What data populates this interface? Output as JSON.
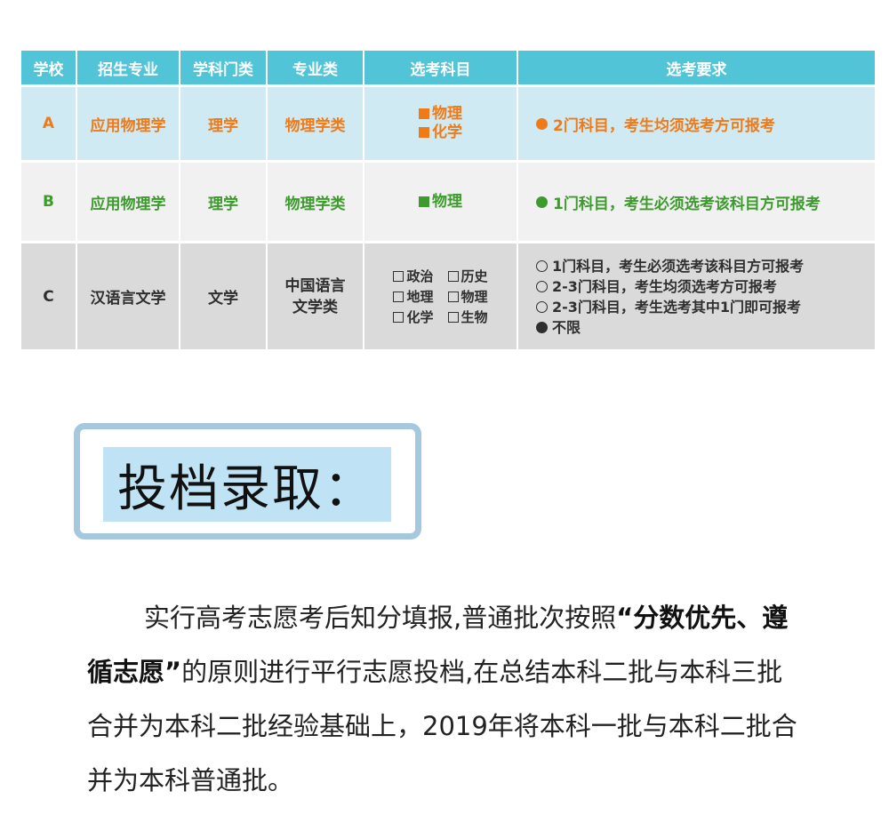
{
  "table": {
    "headers": [
      "学校",
      "招生专业",
      "学科门类",
      "专业类",
      "选考科目",
      "选考要求"
    ],
    "rows": [
      {
        "school": "A",
        "major": "应用物理学",
        "category": "理学",
        "field": "物理学类",
        "subjects": [
          "物理",
          "化学"
        ],
        "requirement": "2门科目，考生均须选考方可报考"
      },
      {
        "school": "B",
        "major": "应用物理学",
        "category": "理学",
        "field": "物理学类",
        "subjects": [
          "物理"
        ],
        "requirement": "1门科目，考生必须选考该科目方可报考"
      },
      {
        "school": "C",
        "major": "汉语言文学",
        "category": "文学",
        "field_line1": "中国语言",
        "field_line2": "文学类",
        "subjects": [
          "政治",
          "历史",
          "地理",
          "物理",
          "化学",
          "生物"
        ],
        "requirements": [
          "1门科目，考生必须选考该科目方可报考",
          "2-3门科目，考生均须选考方可报考",
          "2-3门科目，考生选考其中1门即可报考",
          "不限"
        ]
      }
    ],
    "colors": {
      "header": "#52c4d8",
      "rowA_text": "#f07a18",
      "rowB_text": "#3c9b2c",
      "rowC_text": "#2f2f2f"
    }
  },
  "section": {
    "title": "投档录取："
  },
  "paragraph": {
    "part1": "实行高考志愿考后知分填报,普通批次按照",
    "emphasis": "“分数优先、遵循志愿”",
    "part2": "的原则进行平行志愿投档,在总结本科二批与本科三批合并为本科二批经验基础上，2019年将本科一批与本科二批合并为本科普通批。"
  }
}
